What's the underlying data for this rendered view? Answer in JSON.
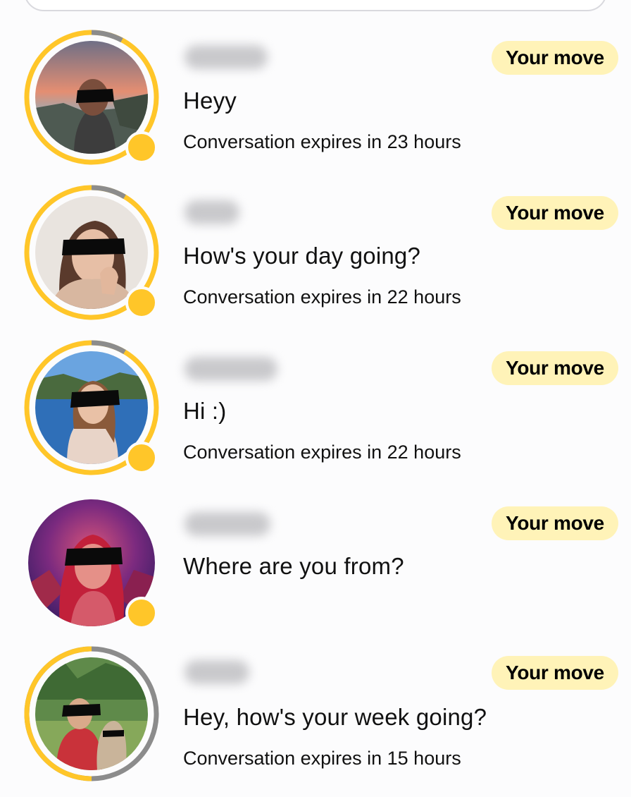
{
  "colors": {
    "accent": "#ffc629",
    "badge_bg": "#fff3b8",
    "ring_track": "#8c8c8c"
  },
  "conversations": [
    {
      "message": "Heyy",
      "expiry": "Conversation expires in 23 hours",
      "badge": "Your move"
    },
    {
      "message": "How's your day going?",
      "expiry": "Conversation expires in 22 hours",
      "badge": "Your move"
    },
    {
      "message": "Hi :)",
      "expiry": "Conversation expires in 22 hours",
      "badge": "Your move"
    },
    {
      "message": "Where are you from?",
      "expiry": "",
      "badge": "Your move"
    },
    {
      "message": "Hey, how's your week going?",
      "expiry": "Conversation expires in 15 hours",
      "badge": "Your move"
    }
  ]
}
